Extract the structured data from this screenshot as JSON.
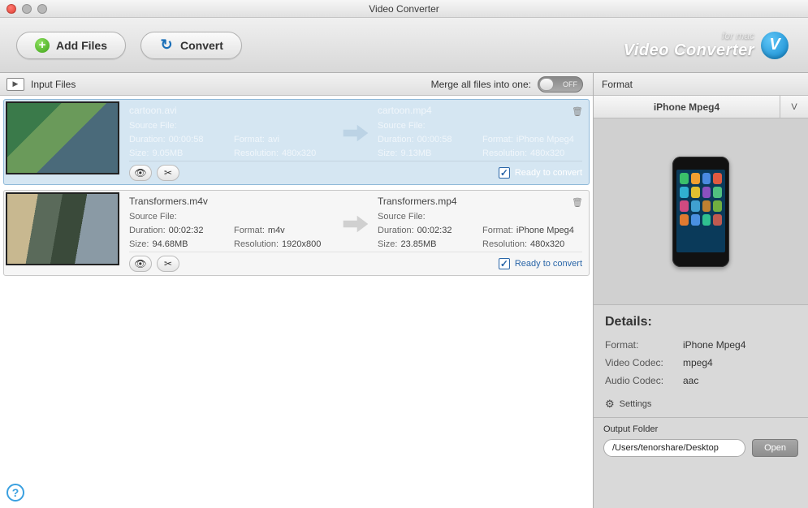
{
  "window": {
    "title": "Video Converter"
  },
  "toolbar": {
    "add_files_label": "Add Files",
    "convert_label": "Convert"
  },
  "brand": {
    "top": "for mac",
    "bottom": "Video Converter",
    "badge": "V"
  },
  "input_header": {
    "label": "Input Files",
    "merge_label": "Merge all files into one:",
    "merge_state": "OFF"
  },
  "files": [
    {
      "selected": true,
      "source": {
        "name": "cartoon.avi",
        "source_file_label": "Source File:",
        "duration_label": "Duration:",
        "duration": "00:00:58",
        "format_label": "Format:",
        "format": "avi",
        "size_label": "Size:",
        "size": "9.05MB",
        "resolution_label": "Resolution:",
        "resolution": "480x320"
      },
      "target": {
        "name": "cartoon.mp4",
        "source_file_label": "Source File:",
        "duration_label": "Duration:",
        "duration": "00:00:58",
        "format_label": "Format:",
        "format": "iPhone Mpeg4",
        "size_label": "Size:",
        "size": "9.13MB",
        "resolution_label": "Resolution:",
        "resolution": "480x320"
      },
      "ready_label": "Ready to convert"
    },
    {
      "selected": false,
      "source": {
        "name": "Transformers.m4v",
        "source_file_label": "Source File:",
        "duration_label": "Duration:",
        "duration": "00:02:32",
        "format_label": "Format:",
        "format": "m4v",
        "size_label": "Size:",
        "size": "94.68MB",
        "resolution_label": "Resolution:",
        "resolution": "1920x800"
      },
      "target": {
        "name": "Transformers.mp4",
        "source_file_label": "Source File:",
        "duration_label": "Duration:",
        "duration": "00:02:32",
        "format_label": "Format:",
        "format": "iPhone Mpeg4",
        "size_label": "Size:",
        "size": "23.85MB",
        "resolution_label": "Resolution:",
        "resolution": "480x320"
      },
      "ready_label": "Ready to convert"
    }
  ],
  "format_panel": {
    "header": "Format",
    "current": "iPhone Mpeg4",
    "dropdown_hint": "V"
  },
  "details": {
    "heading": "Details:",
    "format_label": "Format:",
    "format_value": "iPhone Mpeg4",
    "video_codec_label": "Video Codec:",
    "video_codec_value": "mpeg4",
    "audio_codec_label": "Audio Codec:",
    "audio_codec_value": "aac",
    "settings_label": "Settings"
  },
  "output": {
    "label": "Output Folder",
    "path": "/Users/tenorshare/Desktop",
    "open_label": "Open"
  },
  "help_glyph": "?"
}
